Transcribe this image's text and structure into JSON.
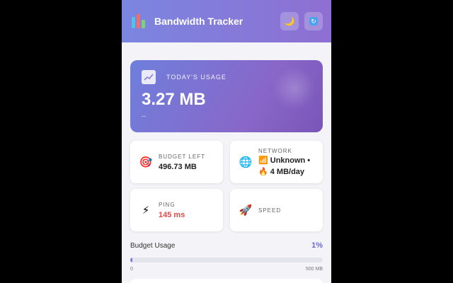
{
  "header": {
    "title": "Bandwidth Tracker",
    "theme_icon": "moon-icon",
    "refresh_icon": "refresh-icon",
    "refresh_glyph": "↻"
  },
  "usage": {
    "label": "TODAY'S USAGE",
    "value": "3.27 MB",
    "sub": "--"
  },
  "stats": {
    "budget": {
      "label": "BUDGET LEFT",
      "value": "496.73 MB",
      "icon": "target-icon"
    },
    "network": {
      "label": "NETWORK",
      "line1": "📶 Unknown •",
      "line2": "🔥 4 MB/day",
      "icon": "globe-icon"
    },
    "ping": {
      "label": "PING",
      "value": "145 ms",
      "icon": "lightning-icon"
    },
    "speed": {
      "label": "SPEED",
      "icon": "rocket-icon"
    }
  },
  "budget_usage": {
    "label": "Budget Usage",
    "percent_label": "1%",
    "percent": 1,
    "min_label": "0",
    "max_label": "500 MB"
  },
  "colors": {
    "accent": "#7b7fdc",
    "ping": "#e04848"
  }
}
